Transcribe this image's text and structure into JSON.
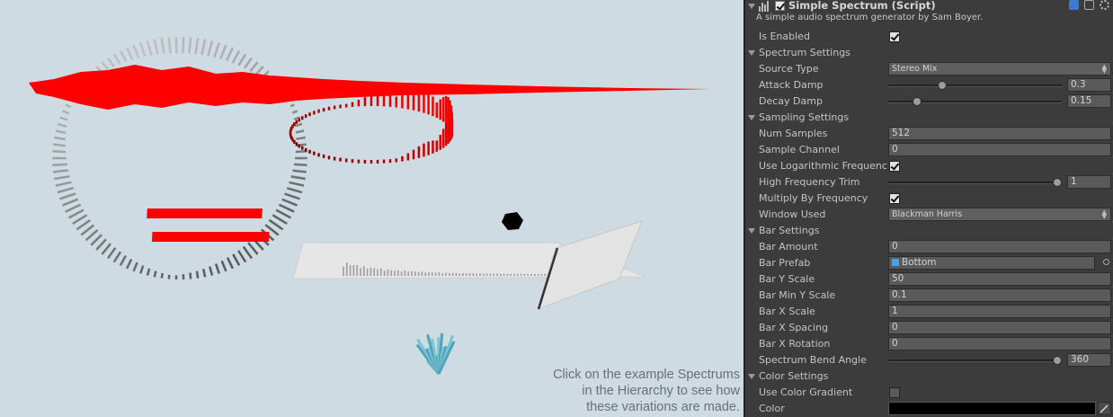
{
  "scene": {
    "hint_lines": [
      "Click on the example Spectrums",
      "in the Hierarchy to see how",
      "these variations are made."
    ],
    "colors": {
      "background": "#cedbe2",
      "red": "#ff0000",
      "dark_red": "#7a0000"
    }
  },
  "component": {
    "title": "Simple Spectrum (Script)",
    "description": "A simple audio spectrum generator by Sam Boyer.",
    "header_icons": [
      "bar-chart-icon",
      "enabled-checkbox",
      "book-help-icon",
      "preset-icon",
      "gear-icon"
    ]
  },
  "rows": {
    "is_enabled": {
      "label": "Is Enabled",
      "checked": true
    },
    "spectrum_settings": {
      "label": "Spectrum Settings"
    },
    "source_type": {
      "label": "Source Type",
      "value": "Stereo Mix"
    },
    "attack_damp": {
      "label": "Attack Damp",
      "value": "0.3",
      "fraction": 0.3
    },
    "decay_damp": {
      "label": "Decay Damp",
      "value": "0.15",
      "fraction": 0.15
    },
    "sampling_settings": {
      "label": "Sampling Settings"
    },
    "num_samples": {
      "label": "Num Samples",
      "value": "512"
    },
    "sample_channel": {
      "label": "Sample Channel",
      "value": "0"
    },
    "use_log_freq": {
      "label": "Use Logarithmic Frequency",
      "checked": true
    },
    "high_freq_trim": {
      "label": "High Frequency Trim",
      "value": "1",
      "fraction": 1.0
    },
    "multiply_by_freq": {
      "label": "Multiply By Frequency",
      "checked": true
    },
    "window_used": {
      "label": "Window Used",
      "value": "Blackman Harris"
    },
    "bar_settings": {
      "label": "Bar Settings"
    },
    "bar_amount": {
      "label": "Bar Amount",
      "value": "0"
    },
    "bar_prefab": {
      "label": "Bar Prefab",
      "value": "Bottom"
    },
    "bar_y_scale": {
      "label": "Bar Y Scale",
      "value": "50"
    },
    "bar_min_y_scale": {
      "label": "Bar Min Y Scale",
      "value": "0.1"
    },
    "bar_x_scale": {
      "label": "Bar X Scale",
      "value": "1"
    },
    "bar_x_spacing": {
      "label": "Bar X Spacing",
      "value": "0"
    },
    "bar_x_rotation": {
      "label": "Bar X Rotation",
      "value": "0"
    },
    "spectrum_bend_angle": {
      "label": "Spectrum Bend Angle",
      "value": "360",
      "fraction": 1.0
    },
    "color_settings": {
      "label": "Color Settings"
    },
    "use_color_gradient": {
      "label": "Use Color Gradient",
      "checked": false
    },
    "color": {
      "label": "Color",
      "swatch": "#000000"
    }
  }
}
